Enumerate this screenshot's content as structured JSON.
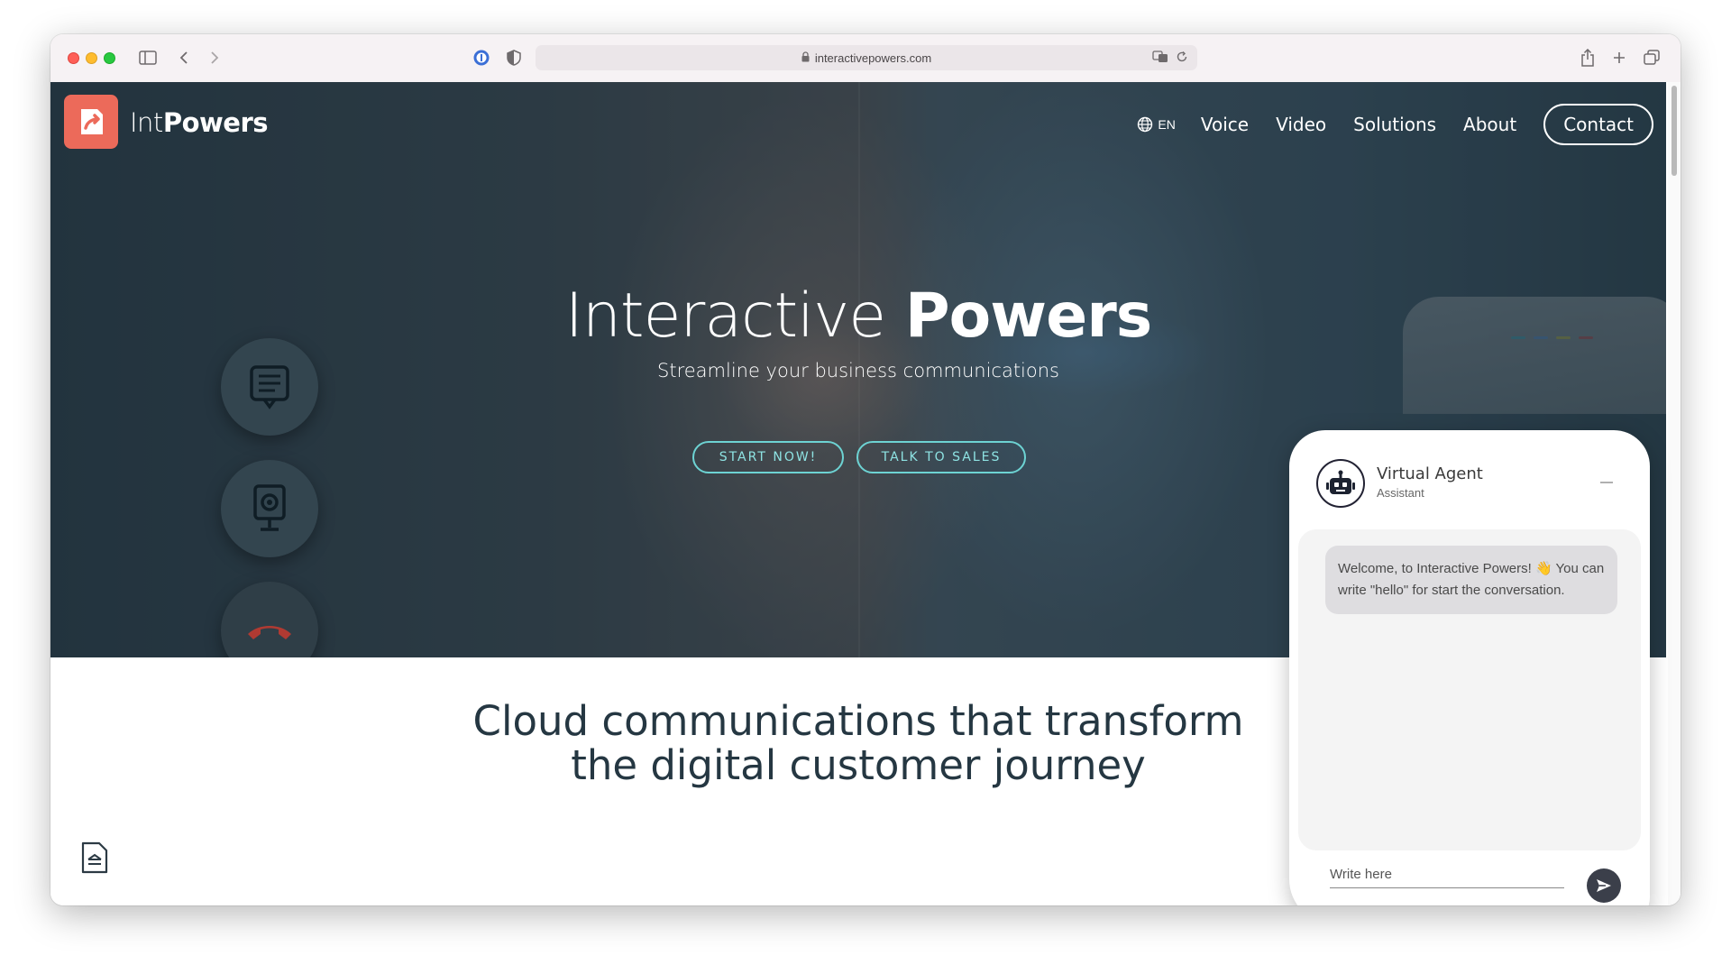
{
  "browser": {
    "url": "interactivepowers.com"
  },
  "site": {
    "logo": {
      "name_thin": "Int",
      "name_bold": "Powers"
    },
    "nav": {
      "lang": "EN",
      "items": [
        "Voice",
        "Video",
        "Solutions",
        "About"
      ],
      "contact": "Contact"
    },
    "hero": {
      "title_light": "Interactive",
      "title_bold": "Powers",
      "subtitle": "Streamline your business communications",
      "cta_start": "START NOW!",
      "cta_sales": "TALK TO SALES"
    },
    "section": {
      "line1": "Cloud communications that transform",
      "line2": "the digital customer journey"
    }
  },
  "chat": {
    "agent_name": "Virtual Agent",
    "agent_role": "Assistant",
    "welcome_message": "Welcome, to Interactive Powers! 👋 You can write \"hello\" for start the conversation.",
    "input_placeholder": "Write here"
  },
  "colors": {
    "brand": "#ec6a5a",
    "cta_outline": "#6dd3d3",
    "heading": "#253742"
  }
}
